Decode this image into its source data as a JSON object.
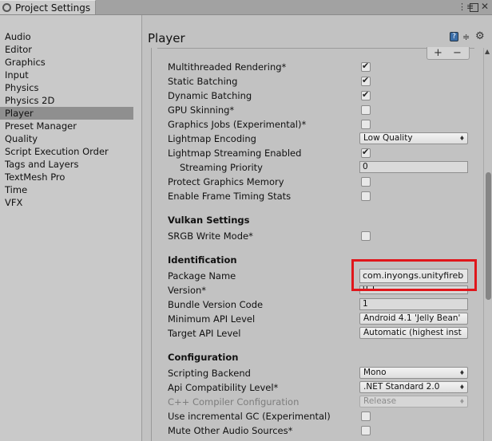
{
  "window": {
    "tab_title": "Project Settings",
    "controls": {
      "menu": "⋮≡",
      "close": "✕"
    }
  },
  "sidebar": {
    "items": [
      {
        "label": "Audio"
      },
      {
        "label": "Editor"
      },
      {
        "label": "Graphics"
      },
      {
        "label": "Input"
      },
      {
        "label": "Physics"
      },
      {
        "label": "Physics 2D"
      },
      {
        "label": "Player"
      },
      {
        "label": "Preset Manager"
      },
      {
        "label": "Quality"
      },
      {
        "label": "Script Execution Order"
      },
      {
        "label": "Tags and Layers"
      },
      {
        "label": "TextMesh Pro"
      },
      {
        "label": "Time"
      },
      {
        "label": "VFX"
      }
    ],
    "selected": "Player"
  },
  "main": {
    "title": "Player",
    "list_buttons": {
      "plus": "+",
      "minus": "−"
    },
    "other_rows": [
      {
        "label": "Multithreaded Rendering*",
        "checked": true
      },
      {
        "label": "Static Batching",
        "checked": true
      },
      {
        "label": "Dynamic Batching",
        "checked": true
      },
      {
        "label": "GPU Skinning*",
        "checked": false
      },
      {
        "label": "Graphics Jobs (Experimental)*",
        "checked": false
      }
    ],
    "lightmap_encoding": {
      "label": "Lightmap Encoding",
      "value": "Low Quality"
    },
    "lightmap_streaming": {
      "label": "Lightmap Streaming Enabled",
      "checked": true
    },
    "streaming_priority": {
      "label": "Streaming Priority",
      "value": "0"
    },
    "protect_memory": {
      "label": "Protect Graphics Memory",
      "checked": false
    },
    "frame_timing": {
      "label": "Enable Frame Timing Stats",
      "checked": false
    },
    "vulkan": {
      "heading": "Vulkan Settings",
      "srgb": {
        "label": "SRGB Write Mode*",
        "checked": false
      }
    },
    "identification": {
      "heading": "Identification",
      "package_name": {
        "label": "Package Name",
        "value": "com.inyongs.unityfireb"
      },
      "version": {
        "label": "Version*",
        "value": "0.1"
      },
      "bundle_code": {
        "label": "Bundle Version Code",
        "value": "1"
      },
      "min_api": {
        "label": "Minimum API Level",
        "value": "Android 4.1 'Jelly Bean'"
      },
      "target_api": {
        "label": "Target API Level",
        "value": "Automatic (highest inst"
      }
    },
    "configuration": {
      "heading": "Configuration",
      "scripting_backend": {
        "label": "Scripting Backend",
        "value": "Mono"
      },
      "api_compat": {
        "label": "Api Compatibility Level*",
        "value": ".NET Standard 2.0"
      },
      "cpp_config": {
        "label": "C++ Compiler Configuration",
        "value": "Release"
      },
      "incremental_gc": {
        "label": "Use incremental GC (Experimental)",
        "checked": false
      },
      "mute_audio": {
        "label": "Mute Other Audio Sources*",
        "checked": false
      }
    }
  },
  "colors": {
    "highlight": "#e0161b",
    "selected_bg": "#8f8f8f"
  }
}
